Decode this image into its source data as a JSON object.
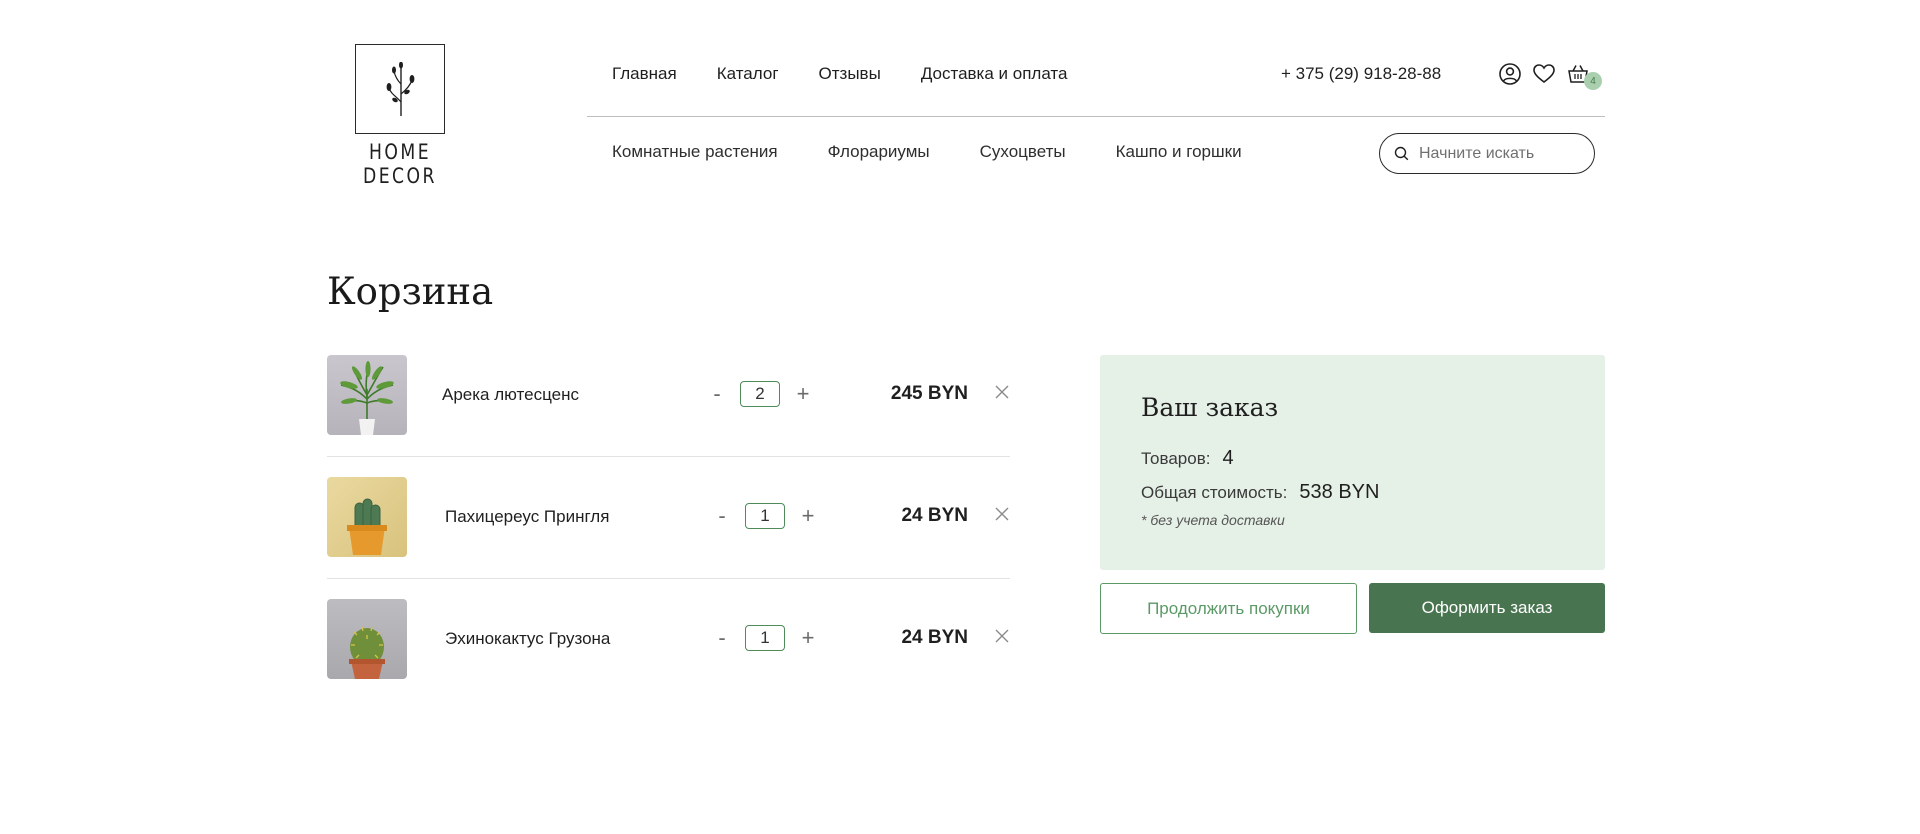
{
  "logo": {
    "text": "HOME DECOR"
  },
  "top_nav": [
    {
      "label": "Главная"
    },
    {
      "label": "Каталог"
    },
    {
      "label": "Отзывы"
    },
    {
      "label": "Доставка и оплата"
    }
  ],
  "phone": "+ 375 (29) 918-28-88",
  "cart_count": "4",
  "categories": [
    {
      "label": "Комнатные растения"
    },
    {
      "label": "Флорариумы"
    },
    {
      "label": "Сухоцветы"
    },
    {
      "label": "Кашпо и горшки"
    }
  ],
  "search": {
    "placeholder": "Начните искать"
  },
  "page_title": "Корзина",
  "cart_items": [
    {
      "name": "Арека лютесценс",
      "quantity": "2",
      "price": "245 BYN",
      "minus": "-",
      "plus": "+"
    },
    {
      "name": "Пахицереус Прингля",
      "quantity": "1",
      "price": "24 BYN",
      "minus": "-",
      "plus": "+"
    },
    {
      "name": "Эхинокактус Грузона",
      "quantity": "1",
      "price": "24 BYN",
      "minus": "-",
      "plus": "+"
    }
  ],
  "summary": {
    "title": "Ваш заказ",
    "items_label": "Товаров:",
    "items_value": "4",
    "total_label": "Общая стоимость:",
    "total_value": "538 BYN",
    "note": "* без учета доставки"
  },
  "buttons": {
    "continue": "Продолжить покупки",
    "checkout": "Оформить заказ"
  },
  "icons": [
    "user-icon",
    "heart-icon",
    "basket-icon",
    "search-icon",
    "close-icon"
  ],
  "colors": {
    "accent": "#487550",
    "accent_light": "#5b9a67",
    "summary_bg": "#e5f0e7",
    "badge_bg": "#a9cfae"
  }
}
